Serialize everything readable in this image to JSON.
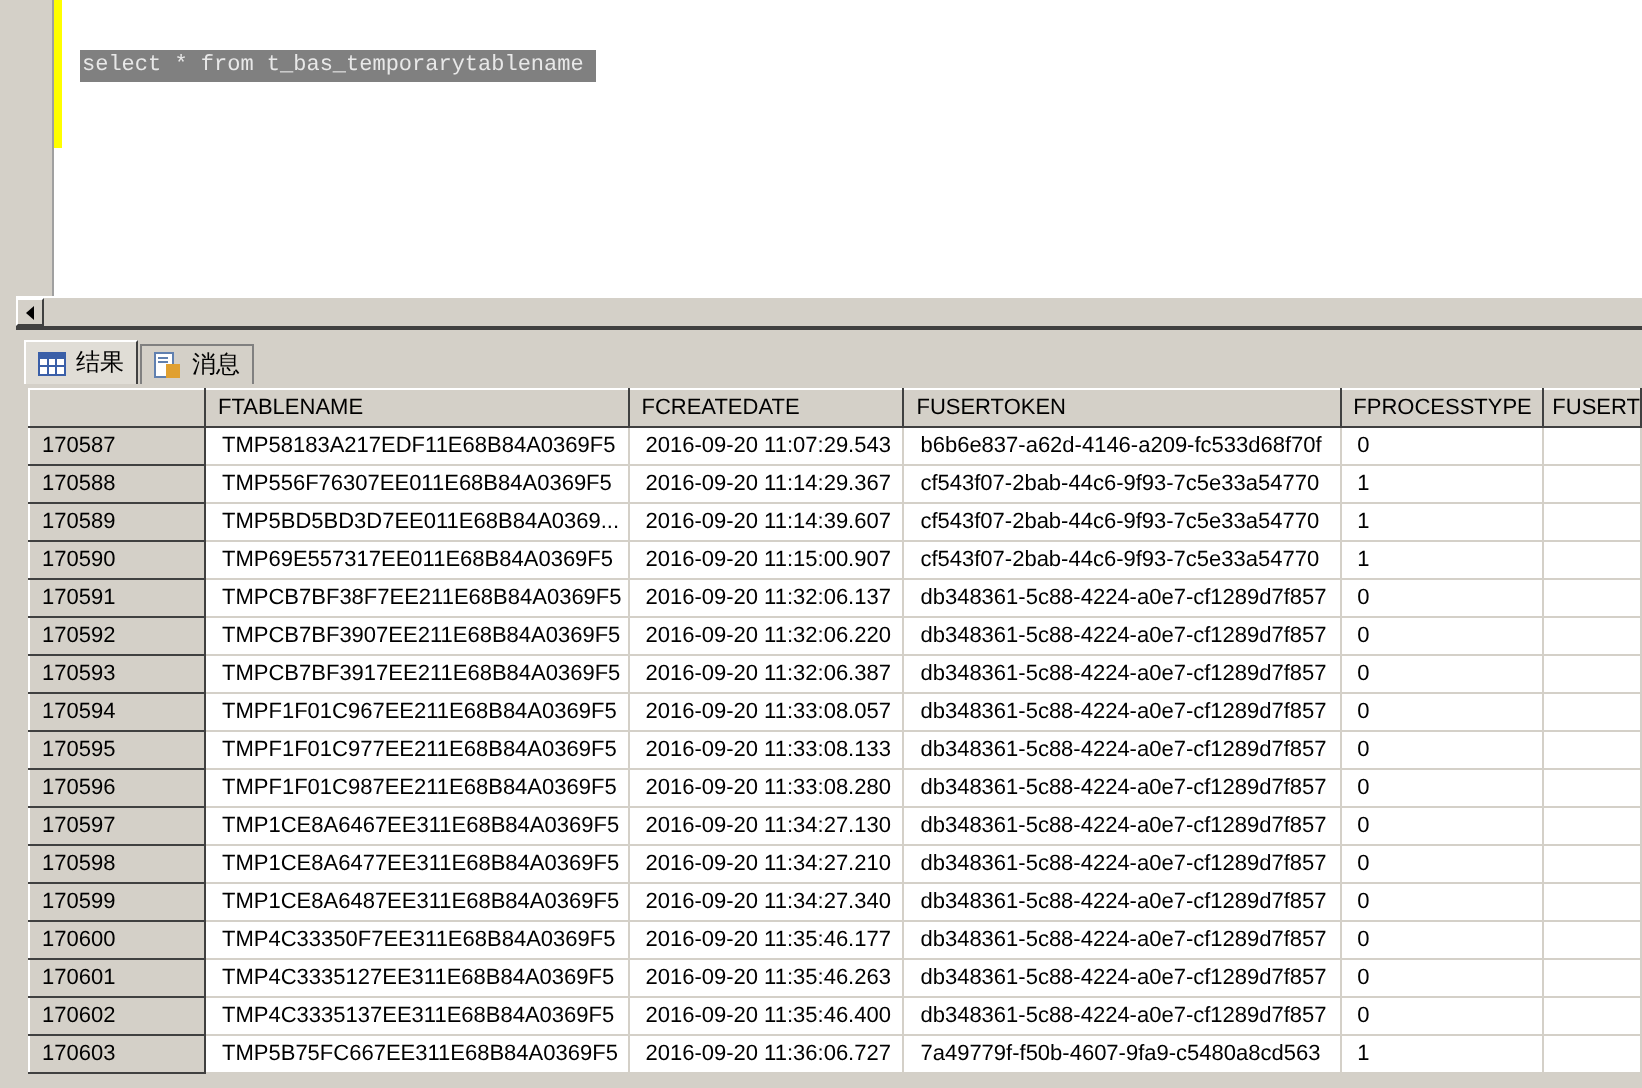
{
  "editor": {
    "selected_query": "select * from t_bas_temporarytablename"
  },
  "tabs": [
    {
      "label": "结果",
      "selected": true
    },
    {
      "label": "消息",
      "selected": false
    }
  ],
  "table": {
    "columns": [
      "FTABLENAME",
      "FCREATEDATE",
      "FUSERTOKEN",
      "FPROCESSTYPE",
      "FUSERT"
    ],
    "rows": [
      {
        "id": "170587",
        "cells": [
          "TMP58183A217EDF11E68B84A0369F5",
          "2016-09-20 11:07:29.543",
          "b6b6e837-a62d-4146-a209-fc533d68f70f",
          "0"
        ]
      },
      {
        "id": "170588",
        "cells": [
          "TMP556F76307EE011E68B84A0369F5",
          "2016-09-20 11:14:29.367",
          "cf543f07-2bab-44c6-9f93-7c5e33a54770",
          "1"
        ]
      },
      {
        "id": "170589",
        "cells": [
          "TMP5BD5BD3D7EE011E68B84A0369...",
          "2016-09-20 11:14:39.607",
          "cf543f07-2bab-44c6-9f93-7c5e33a54770",
          "1"
        ]
      },
      {
        "id": "170590",
        "cells": [
          "TMP69E557317EE011E68B84A0369F5",
          "2016-09-20 11:15:00.907",
          "cf543f07-2bab-44c6-9f93-7c5e33a54770",
          "1"
        ]
      },
      {
        "id": "170591",
        "cells": [
          "TMPCB7BF38F7EE211E68B84A0369F5",
          "2016-09-20 11:32:06.137",
          "db348361-5c88-4224-a0e7-cf1289d7f857",
          "0"
        ]
      },
      {
        "id": "170592",
        "cells": [
          "TMPCB7BF3907EE211E68B84A0369F5",
          "2016-09-20 11:32:06.220",
          "db348361-5c88-4224-a0e7-cf1289d7f857",
          "0"
        ]
      },
      {
        "id": "170593",
        "cells": [
          "TMPCB7BF3917EE211E68B84A0369F5",
          "2016-09-20 11:32:06.387",
          "db348361-5c88-4224-a0e7-cf1289d7f857",
          "0"
        ]
      },
      {
        "id": "170594",
        "cells": [
          "TMPF1F01C967EE211E68B84A0369F5",
          "2016-09-20 11:33:08.057",
          "db348361-5c88-4224-a0e7-cf1289d7f857",
          "0"
        ]
      },
      {
        "id": "170595",
        "cells": [
          "TMPF1F01C977EE211E68B84A0369F5",
          "2016-09-20 11:33:08.133",
          "db348361-5c88-4224-a0e7-cf1289d7f857",
          "0"
        ]
      },
      {
        "id": "170596",
        "cells": [
          "TMPF1F01C987EE211E68B84A0369F5",
          "2016-09-20 11:33:08.280",
          "db348361-5c88-4224-a0e7-cf1289d7f857",
          "0"
        ]
      },
      {
        "id": "170597",
        "cells": [
          "TMP1CE8A6467EE311E68B84A0369F5",
          "2016-09-20 11:34:27.130",
          "db348361-5c88-4224-a0e7-cf1289d7f857",
          "0"
        ]
      },
      {
        "id": "170598",
        "cells": [
          "TMP1CE8A6477EE311E68B84A0369F5",
          "2016-09-20 11:34:27.210",
          "db348361-5c88-4224-a0e7-cf1289d7f857",
          "0"
        ]
      },
      {
        "id": "170599",
        "cells": [
          "TMP1CE8A6487EE311E68B84A0369F5",
          "2016-09-20 11:34:27.340",
          "db348361-5c88-4224-a0e7-cf1289d7f857",
          "0"
        ]
      },
      {
        "id": "170600",
        "cells": [
          "TMP4C33350F7EE311E68B84A0369F5",
          "2016-09-20 11:35:46.177",
          "db348361-5c88-4224-a0e7-cf1289d7f857",
          "0"
        ]
      },
      {
        "id": "170601",
        "cells": [
          "TMP4C3335127EE311E68B84A0369F5",
          "2016-09-20 11:35:46.263",
          "db348361-5c88-4224-a0e7-cf1289d7f857",
          "0"
        ]
      },
      {
        "id": "170602",
        "cells": [
          "TMP4C3335137EE311E68B84A0369F5",
          "2016-09-20 11:35:46.400",
          "db348361-5c88-4224-a0e7-cf1289d7f857",
          "0"
        ]
      },
      {
        "id": "170603",
        "cells": [
          "TMP5B75FC667EE311E68B84A0369F5",
          "2016-09-20 11:36:06.727",
          "7a49779f-f50b-4607-9fa9-c5480a8cd563",
          "1"
        ]
      }
    ]
  }
}
